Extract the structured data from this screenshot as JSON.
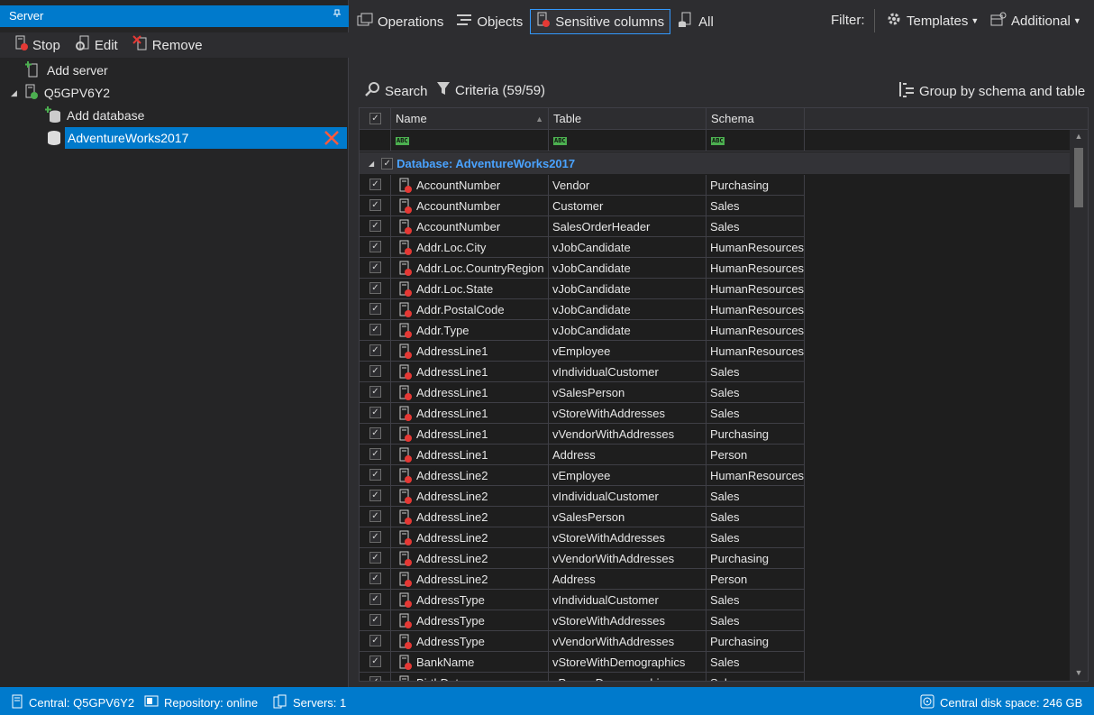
{
  "left_panel": {
    "title": "Server",
    "pin_glyph": "▐",
    "toolbar": {
      "stop": "Stop",
      "edit": "Edit",
      "remove": "Remove"
    },
    "tree": {
      "add_server": "Add server",
      "server": "Q5GPV6Y2",
      "add_database": "Add database",
      "database": "AdventureWorks2017"
    }
  },
  "toolbar": {
    "operations": "Operations",
    "objects": "Objects",
    "sensitive_columns": "Sensitive columns",
    "all": "All",
    "filter": "Filter:",
    "templates": "Templates",
    "additional": "Additional"
  },
  "subtoolbar": {
    "search": "Search",
    "criteria": "Criteria (59/59)",
    "group": "Group by schema and table"
  },
  "grid": {
    "headers": {
      "name": "Name",
      "table": "Table",
      "schema": "Schema"
    },
    "filter_glyph": "ABC",
    "group_label": "Database: AdventureWorks2017",
    "rows": [
      {
        "name": "AccountNumber",
        "table": "Vendor",
        "schema": "Purchasing"
      },
      {
        "name": "AccountNumber",
        "table": "Customer",
        "schema": "Sales"
      },
      {
        "name": "AccountNumber",
        "table": "SalesOrderHeader",
        "schema": "Sales"
      },
      {
        "name": "Addr.Loc.City",
        "table": "vJobCandidate",
        "schema": "HumanResources"
      },
      {
        "name": "Addr.Loc.CountryRegion",
        "table": "vJobCandidate",
        "schema": "HumanResources"
      },
      {
        "name": "Addr.Loc.State",
        "table": "vJobCandidate",
        "schema": "HumanResources"
      },
      {
        "name": "Addr.PostalCode",
        "table": "vJobCandidate",
        "schema": "HumanResources"
      },
      {
        "name": "Addr.Type",
        "table": "vJobCandidate",
        "schema": "HumanResources"
      },
      {
        "name": "AddressLine1",
        "table": "vEmployee",
        "schema": "HumanResources"
      },
      {
        "name": "AddressLine1",
        "table": "vIndividualCustomer",
        "schema": "Sales"
      },
      {
        "name": "AddressLine1",
        "table": "vSalesPerson",
        "schema": "Sales"
      },
      {
        "name": "AddressLine1",
        "table": "vStoreWithAddresses",
        "schema": "Sales"
      },
      {
        "name": "AddressLine1",
        "table": "vVendorWithAddresses",
        "schema": "Purchasing"
      },
      {
        "name": "AddressLine1",
        "table": "Address",
        "schema": "Person"
      },
      {
        "name": "AddressLine2",
        "table": "vEmployee",
        "schema": "HumanResources"
      },
      {
        "name": "AddressLine2",
        "table": "vIndividualCustomer",
        "schema": "Sales"
      },
      {
        "name": "AddressLine2",
        "table": "vSalesPerson",
        "schema": "Sales"
      },
      {
        "name": "AddressLine2",
        "table": "vStoreWithAddresses",
        "schema": "Sales"
      },
      {
        "name": "AddressLine2",
        "table": "vVendorWithAddresses",
        "schema": "Purchasing"
      },
      {
        "name": "AddressLine2",
        "table": "Address",
        "schema": "Person"
      },
      {
        "name": "AddressType",
        "table": "vIndividualCustomer",
        "schema": "Sales"
      },
      {
        "name": "AddressType",
        "table": "vStoreWithAddresses",
        "schema": "Sales"
      },
      {
        "name": "AddressType",
        "table": "vVendorWithAddresses",
        "schema": "Purchasing"
      },
      {
        "name": "BankName",
        "table": "vStoreWithDemographics",
        "schema": "Sales"
      },
      {
        "name": "BirthDate",
        "table": "vPersonDemographics",
        "schema": "Sales"
      }
    ]
  },
  "status": {
    "central": "Central: Q5GPV6Y2",
    "repository": "Repository: online",
    "servers": "Servers: 1",
    "disk": "Central disk space: 246 GB"
  },
  "colors": {
    "accent": "#007acc",
    "group_text": "#4aa3ff",
    "sensitive_dot": "#e53935"
  }
}
